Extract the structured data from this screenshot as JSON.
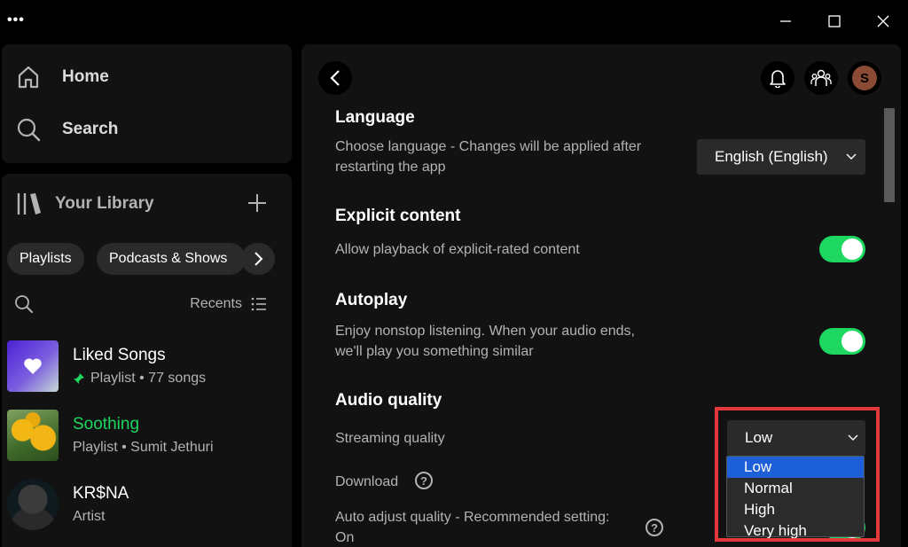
{
  "titlebar": {
    "menu_dots": "•••"
  },
  "sidebar": {
    "nav": [
      {
        "label": "Home"
      },
      {
        "label": "Search"
      }
    ],
    "library": {
      "title": "Your Library",
      "chips": [
        "Playlists",
        "Podcasts & Shows"
      ],
      "sort_label": "Recents",
      "items": [
        {
          "title": "Liked Songs",
          "subtitle": "Playlist • 77 songs"
        },
        {
          "title": "Soothing",
          "subtitle": "Playlist • Sumit Jethuri"
        },
        {
          "title": "KR$NA",
          "subtitle": "Artist"
        }
      ]
    }
  },
  "header": {
    "avatar_initial": "S"
  },
  "settings": {
    "language": {
      "title": "Language",
      "desc_line1": "Choose language - Changes will be applied after",
      "desc_line2": "restarting the app",
      "value": "English (English)"
    },
    "explicit": {
      "title": "Explicit content",
      "desc": "Allow playback of explicit-rated content",
      "enabled": true
    },
    "autoplay": {
      "title": "Autoplay",
      "desc_line1": "Enjoy nonstop listening. When your audio ends,",
      "desc_line2": "we'll play you something similar",
      "enabled": true
    },
    "audio_quality": {
      "title": "Audio quality",
      "streaming_label": "Streaming quality",
      "streaming_value": "Low",
      "download_label": "Download",
      "auto_adjust_line1": "Auto adjust quality - Recommended setting:",
      "auto_adjust_line2": "On",
      "options": [
        "Low",
        "Normal",
        "High",
        "Very high"
      ],
      "selected_option": "Low"
    }
  },
  "colors": {
    "accent_green": "#1ed760",
    "highlight_red": "#e3393d",
    "selection_blue": "#1d5fd6"
  }
}
